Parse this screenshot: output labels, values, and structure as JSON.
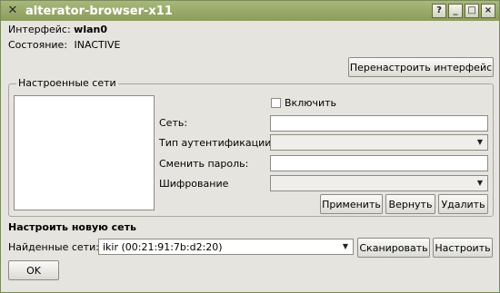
{
  "window": {
    "title": "alterator-browser-x11",
    "buttons": [
      "?",
      "_",
      "□",
      "×"
    ]
  },
  "interface": {
    "label": "Интерфейс:",
    "value": "wlan0"
  },
  "state": {
    "label": "Состояние:",
    "value": "INACTIVE"
  },
  "reconfigure_button": "Перенастроить интерфейс",
  "configured_networks": {
    "title": "Настроенные сети",
    "enable_label": "Включить",
    "network_label": "Сеть:",
    "auth_type_label": "Тип аутентификации:",
    "change_password_label": "Сменить пароль:",
    "encryption_label": "Шифрование",
    "apply_button": "Применить",
    "revert_button": "Вернуть",
    "delete_button": "Удалить"
  },
  "new_network": {
    "heading": "Настроить новую сеть",
    "found_label": "Найденные сети:",
    "found_value": "ikir (00:21:91:7b:d2:20)",
    "scan_button": "Сканировать",
    "configure_button": "Настроить"
  },
  "ok_button": "OK"
}
